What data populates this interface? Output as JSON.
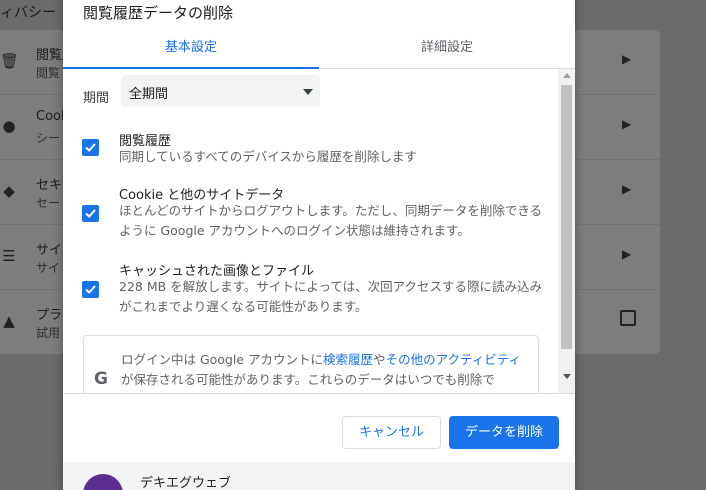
{
  "background": {
    "header": "ィバシー",
    "rows": [
      {
        "title": "閲覧履",
        "sub": "閲覧",
        "icon": "trash-icon"
      },
      {
        "title": "Cook",
        "sub": "シー",
        "icon": "cookie-icon"
      },
      {
        "title": "セキ",
        "sub": "セー",
        "icon": "shield-icon"
      },
      {
        "title": "サイ",
        "sub": "サイ",
        "icon": "sliders-icon"
      },
      {
        "title": "プラ",
        "sub": "試用",
        "icon": "flask-icon"
      }
    ]
  },
  "dialog": {
    "title": "閲覧履歴データの削除",
    "tabs": [
      {
        "label": "基本設定",
        "active": true
      },
      {
        "label": "詳細設定",
        "active": false
      }
    ],
    "period": {
      "label": "期間",
      "value": "全期間"
    },
    "options": [
      {
        "title": "閲覧履歴",
        "desc": "同期しているすべてのデバイスから履歴を削除します",
        "checked": true
      },
      {
        "title": "Cookie と他のサイトデータ",
        "desc": "ほとんどのサイトからログアウトします。ただし、同期データを削除できるように Google アカウントへのログイン状態は維持されます。",
        "checked": true
      },
      {
        "title": "キャッシュされた画像とファイル",
        "desc": "228 MB を解放します。サイトによっては、次回アクセスする際に読み込みがこれまでより遅くなる可能性があります。",
        "checked": true
      }
    ],
    "info": {
      "prefix": "ログイン中は Google アカウントに",
      "link1": "検索履歴",
      "mid": "や",
      "link2": "その他のアクティビティ",
      "suffix": "が保存される可能性があります。これらのデータはいつでも削除で"
    },
    "buttons": {
      "cancel": "キャンセル",
      "delete": "データを削除"
    },
    "account": {
      "name": "デキエグウェブ"
    }
  },
  "colors": {
    "accent": "#1a73e8",
    "avatar": "#5c2d91"
  }
}
